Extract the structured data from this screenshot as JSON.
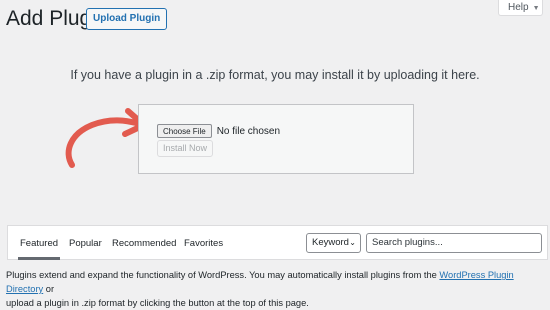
{
  "header": {
    "title": "Add Plugins",
    "upload_button": "Upload Plugin",
    "help_tab": "Help"
  },
  "upload": {
    "instructions": "If you have a plugin in a .zip format, you may install it by uploading it here.",
    "choose_file_button": "Choose File",
    "file_status": "No file chosen",
    "install_button": "Install Now"
  },
  "filter": {
    "tabs": [
      {
        "label": "Featured",
        "current": true
      },
      {
        "label": "Popular"
      },
      {
        "label": "Recommended"
      },
      {
        "label": "Favorites"
      }
    ],
    "search_type": "Keyword",
    "search_placeholder": "Search plugins..."
  },
  "description": {
    "line1_text": "Plugins extend and expand the functionality of WordPress. You may automatically install plugins from the ",
    "link_text": "WordPress Plugin Directory",
    "line1_end": " or",
    "line2_text": "upload a plugin in .zip format by clicking the button at the top of this page."
  },
  "colors": {
    "accent": "#2271b1",
    "annotation_arrow": "#e25b4f",
    "background": "#f0f0f1"
  },
  "icons": {
    "help_caret": "caret-down-icon",
    "select_chevron": "chevron-down-icon",
    "annotation": "curved-arrow-icon"
  }
}
